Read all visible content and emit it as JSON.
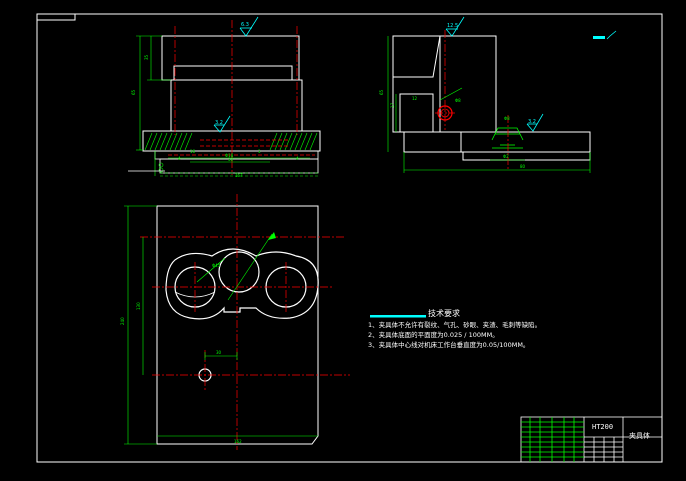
{
  "title_block": {
    "material": "HT200",
    "part_name": "夹具体"
  },
  "tech_requirements": {
    "heading": "技术要求",
    "items": [
      "1、夹具体不允许有裂纹、气孔、砂眼、夹渣、毛刺等缺陷。",
      "2、夹具体底面的平面度为0.025 / 100MM。",
      "3、夹具体中心线对机床工作台垂直度为0.05/100MM。"
    ]
  },
  "roughness_marks": {
    "front_top": "6.3",
    "side_top": "12.5",
    "front_slot": "3.2",
    "side_slot": "3.2"
  },
  "colors": {
    "outline": "#ffffff",
    "dimension": "#00ff00",
    "centerline": "#ff0000",
    "hatch": "#00ff00",
    "text": "#ffffff",
    "accent": "#00ffff",
    "roughness": "#00ffff",
    "callout": "#ffff00"
  }
}
